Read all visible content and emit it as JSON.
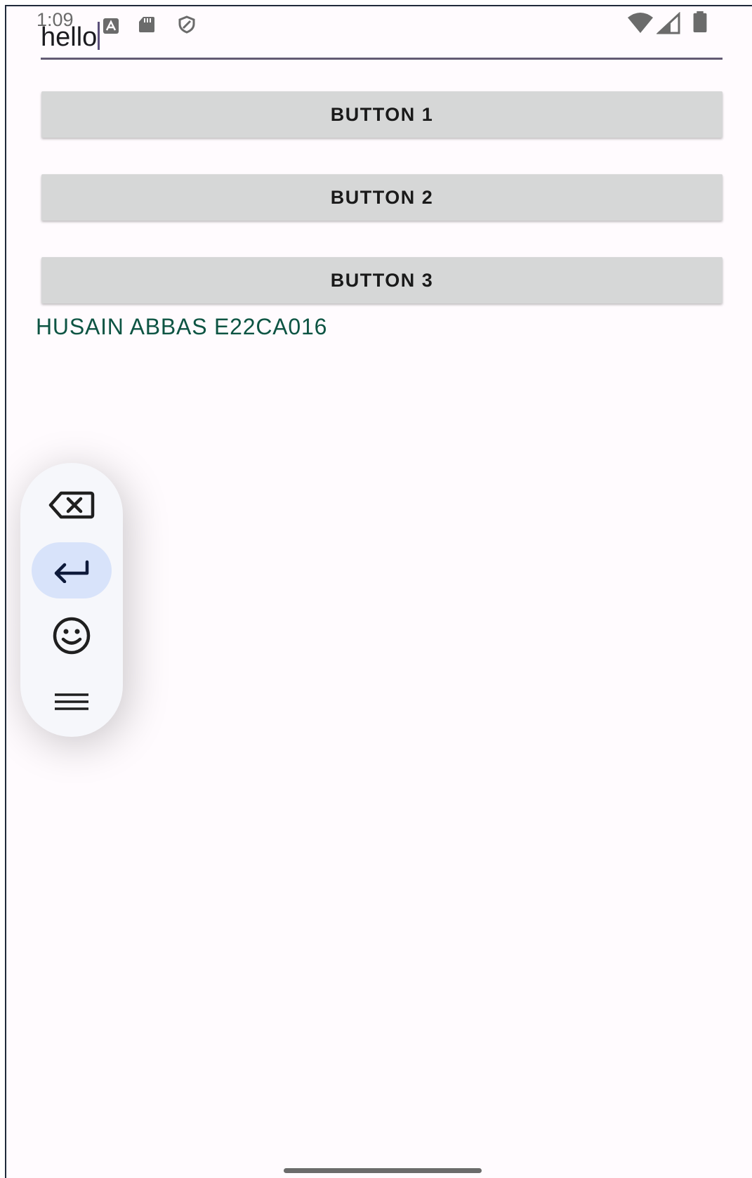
{
  "status_bar": {
    "time": "1:09",
    "icons": [
      "notification-a-icon",
      "sd-card-icon",
      "shield-icon",
      "wifi-icon",
      "cell-signal-icon",
      "battery-icon"
    ]
  },
  "text_field": {
    "value": "hello"
  },
  "buttons": [
    {
      "label": "BUTTON 1"
    },
    {
      "label": "BUTTON 2"
    },
    {
      "label": "BUTTON 3"
    }
  ],
  "name_label": "HUSAIN ABBAS E22CA016",
  "floating_toolbar": {
    "items": [
      "backspace-icon",
      "enter-icon",
      "emoji-icon",
      "menu-icon"
    ],
    "active_item": "enter-icon"
  },
  "colors": {
    "background": "#fffbfe",
    "button": "#d6d7d7",
    "name_label": "#0d5443",
    "underline": "#635a73",
    "toolbar": "#f6f7fb",
    "toolbar_active": "#d8e3fa"
  }
}
